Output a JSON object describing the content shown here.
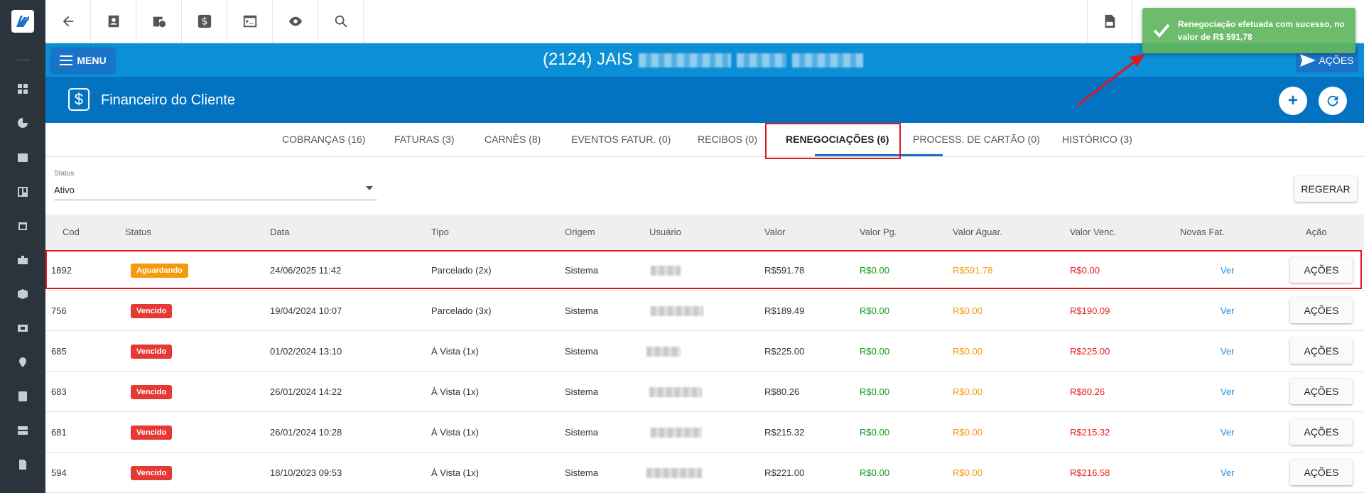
{
  "toolbar": {
    "icons": [
      "back-arrow-icon",
      "contact-card-icon",
      "calendar-clock-icon",
      "dollar-icon",
      "terminal-icon",
      "eye-icon",
      "search-icon",
      "pdf-icon"
    ]
  },
  "header": {
    "menu_label": "MENU",
    "client_title": "(2124) JAIS",
    "actions_label": "AÇÕES"
  },
  "section": {
    "title": "Financeiro do Cliente",
    "icon": "dollar-icon"
  },
  "tabs": [
    {
      "label": "COBRANÇAS (16)"
    },
    {
      "label": "FATURAS (3)"
    },
    {
      "label": "CARNÊS (8)"
    },
    {
      "label": "EVENTOS FATUR. (0)"
    },
    {
      "label": "RECIBOS (0)"
    },
    {
      "label": "RENEGOCIAÇÕES (6)"
    },
    {
      "label": "PROCESS. DE CARTÃO (0)"
    },
    {
      "label": "HISTÓRICO (3)"
    }
  ],
  "filter": {
    "label": "Status",
    "value": "Ativo"
  },
  "regerar_label": "REGERAR",
  "table": {
    "columns": [
      "Cod",
      "Status",
      "Data",
      "Tipo",
      "Origem",
      "Usuário",
      "Valor",
      "Valor Pg.",
      "Valor Aguar.",
      "Valor Venc.",
      "Novas Fat.",
      "Ação"
    ],
    "rows": [
      {
        "cod": "1892",
        "status": "Aguardando",
        "data": "24/06/2025 11:42",
        "tipo": "Parcelado (2x)",
        "origem": "Sistema",
        "valor": "R$591.78",
        "valor_pg": "R$0.00",
        "valor_aguar": "R$591.78",
        "valor_venc": "R$0.00",
        "novas": "Ver",
        "acao": "AÇÕES"
      },
      {
        "cod": "756",
        "status": "Vencido",
        "data": "19/04/2024 10:07",
        "tipo": "Parcelado (3x)",
        "origem": "Sistema",
        "valor": "R$189.49",
        "valor_pg": "R$0.00",
        "valor_aguar": "R$0.00",
        "valor_venc": "R$190.09",
        "novas": "Ver",
        "acao": "AÇÕES"
      },
      {
        "cod": "685",
        "status": "Vencido",
        "data": "01/02/2024 13:10",
        "tipo": "À Vista (1x)",
        "origem": "Sistema",
        "valor": "R$225.00",
        "valor_pg": "R$0.00",
        "valor_aguar": "R$0.00",
        "valor_venc": "R$225.00",
        "novas": "Ver",
        "acao": "AÇÕES"
      },
      {
        "cod": "683",
        "status": "Vencido",
        "data": "26/01/2024 14:22",
        "tipo": "À Vista (1x)",
        "origem": "Sistema",
        "valor": "R$80.26",
        "valor_pg": "R$0.00",
        "valor_aguar": "R$0.00",
        "valor_venc": "R$80.26",
        "novas": "Ver",
        "acao": "AÇÕES"
      },
      {
        "cod": "681",
        "status": "Vencido",
        "data": "26/01/2024 10:28",
        "tipo": "À Vista (1x)",
        "origem": "Sistema",
        "valor": "R$215.32",
        "valor_pg": "R$0.00",
        "valor_aguar": "R$0.00",
        "valor_venc": "R$215.32",
        "novas": "Ver",
        "acao": "AÇÕES"
      },
      {
        "cod": "594",
        "status": "Vencido",
        "data": "18/10/2023 09:53",
        "tipo": "À Vista (1x)",
        "origem": "Sistema",
        "valor": "R$221.00",
        "valor_pg": "R$0.00",
        "valor_aguar": "R$0.00",
        "valor_venc": "R$216.58",
        "novas": "Ver",
        "acao": "AÇÕES"
      }
    ]
  },
  "toast": {
    "message": "Renegociação efetuada com sucesso, no valor de R$ 591,78"
  },
  "colors": {
    "header_blue": "#0b8fd6",
    "section_blue": "#0373c1",
    "sidebar": "#2b333d",
    "status_aguardando": "#f59a0c",
    "status_vencido": "#e53935",
    "highlight_red": "#e0161f",
    "toast_green": "#5fb65f"
  }
}
